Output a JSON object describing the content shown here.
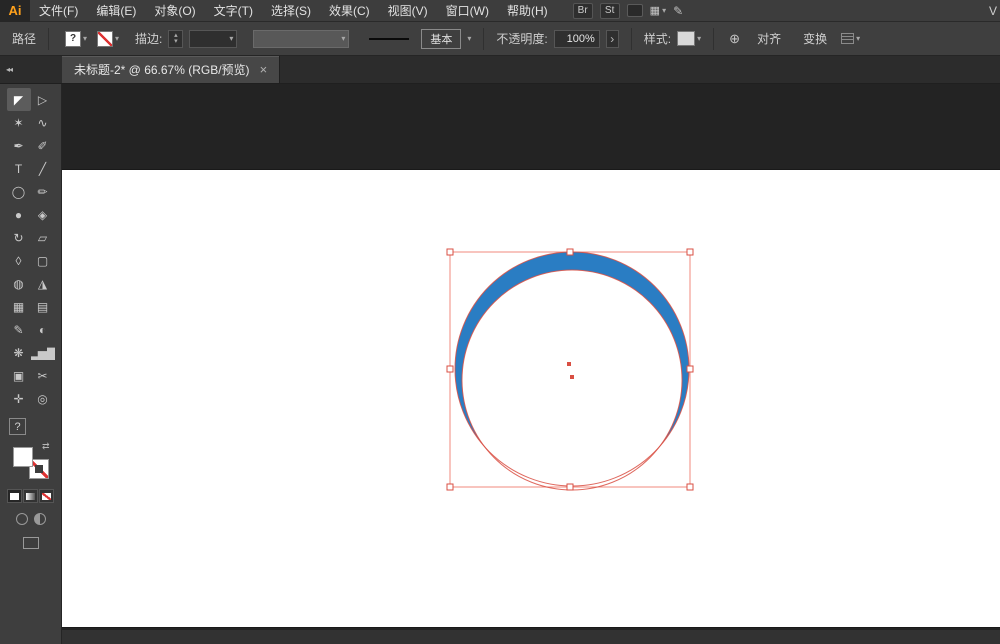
{
  "app": {
    "logo": "Ai",
    "workspace_hint": "V"
  },
  "menu": {
    "items": [
      "文件(F)",
      "编辑(E)",
      "对象(O)",
      "文字(T)",
      "选择(S)",
      "效果(C)",
      "视图(V)",
      "窗口(W)",
      "帮助(H)"
    ],
    "badges": [
      "Br",
      "St"
    ]
  },
  "control_bar": {
    "context": "路径",
    "fill_indicator": "?",
    "stroke_label": "描边:",
    "brush_name": "基本",
    "opacity_label": "不透明度:",
    "opacity_value": "100%",
    "style_label": "样式:",
    "align": "对齐",
    "transform": "变换"
  },
  "tab": {
    "title": "未标题-2* @ 66.67% (RGB/预览)",
    "close": "×"
  },
  "panel": {
    "help": "?"
  },
  "icons": {
    "collapse": "◂◂",
    "layout_grid": "▦",
    "caret": "▾",
    "globe": "⊕",
    "extra": "✎",
    "spinner_up": "▴",
    "spinner_down": "▾",
    "more_arrow": "›",
    "swap": "⇄"
  },
  "tools": [
    {
      "name": "selection-tool",
      "glyph": "◤",
      "selected": true
    },
    {
      "name": "direct-selection-tool",
      "glyph": "▷"
    },
    {
      "name": "magic-wand-tool",
      "glyph": "✶"
    },
    {
      "name": "lasso-tool",
      "glyph": "∿"
    },
    {
      "name": "pen-tool",
      "glyph": "✒"
    },
    {
      "name": "paintbrush-tool",
      "glyph": "✐"
    },
    {
      "name": "type-tool",
      "glyph": "T"
    },
    {
      "name": "line-segment-tool",
      "glyph": "╱"
    },
    {
      "name": "ellipse-tool",
      "glyph": "◯"
    },
    {
      "name": "pencil-tool",
      "glyph": "✏"
    },
    {
      "name": "blob-brush-tool",
      "glyph": "●"
    },
    {
      "name": "eraser-tool",
      "glyph": "◈"
    },
    {
      "name": "rotate-tool",
      "glyph": "↻"
    },
    {
      "name": "scale-tool",
      "glyph": "▱"
    },
    {
      "name": "width-tool",
      "glyph": "◊"
    },
    {
      "name": "free-transform-tool",
      "glyph": "▢"
    },
    {
      "name": "shape-builder-tool",
      "glyph": "◍"
    },
    {
      "name": "perspective-grid-tool",
      "glyph": "◮"
    },
    {
      "name": "mesh-tool",
      "glyph": "▦"
    },
    {
      "name": "gradient-tool",
      "glyph": "▤"
    },
    {
      "name": "eyedropper-tool",
      "glyph": "✎"
    },
    {
      "name": "blend-tool",
      "glyph": "◐"
    },
    {
      "name": "symbol-sprayer-tool",
      "glyph": "❋"
    },
    {
      "name": "column-graph-tool",
      "glyph": "▂▅▇"
    },
    {
      "name": "artboard-tool",
      "glyph": "▣"
    },
    {
      "name": "slice-tool",
      "glyph": "✂"
    },
    {
      "name": "hand-tool",
      "glyph": "✛"
    },
    {
      "name": "zoom-tool",
      "glyph": "◎"
    }
  ],
  "colors": {
    "artwork_blue": "#2a7dc3",
    "selection_red": "#d94f43",
    "bbox_red": "#f08a7e",
    "logo_orange": "#ffa11b"
  },
  "artwork": {
    "description": "selected blue crescent formed by two overlapping circle paths",
    "fill": "#2a7dc3"
  }
}
